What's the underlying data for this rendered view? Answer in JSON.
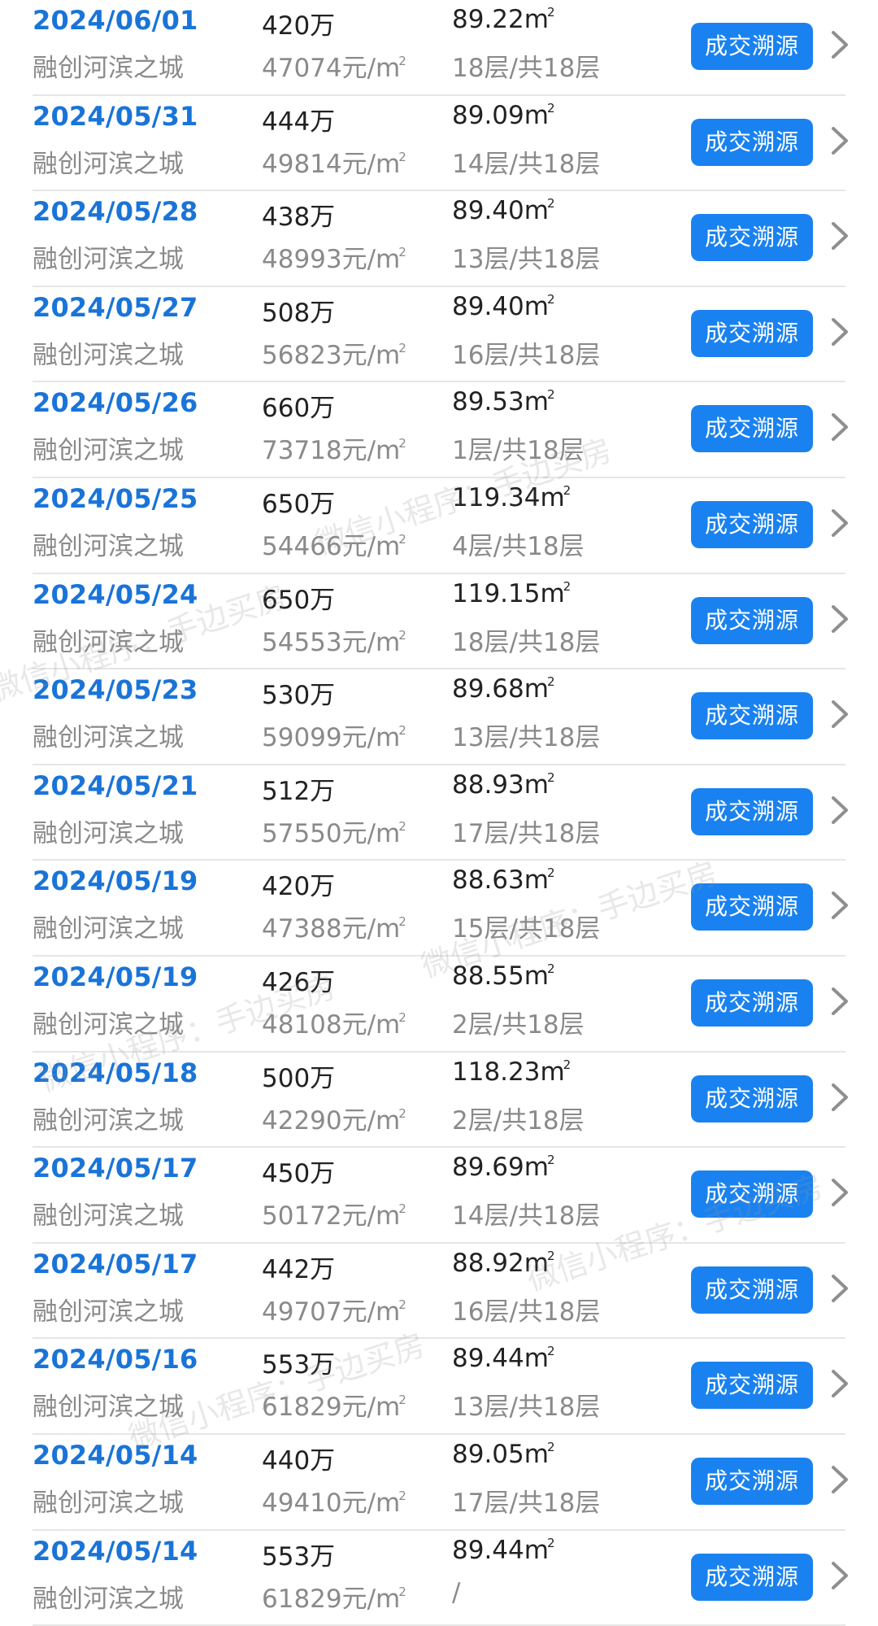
{
  "button_label": "成交溯源",
  "area_unit_sup": "2",
  "watermark_text": "微信小程序：手边买房",
  "icons": {
    "row_chevron": "chevron-right-icon"
  },
  "colors": {
    "date": "#1a74d8",
    "button_bg": "#1a82f0",
    "primary_text": "#222222",
    "secondary_text": "#8a8a8a",
    "divider": "#e6e6e6"
  },
  "rows": [
    {
      "date": "2024/06/01",
      "project": "融创河滨之城",
      "price": "420万",
      "unit_price": "47074元/m",
      "area": "89.22m",
      "floor": "18层/共18层"
    },
    {
      "date": "2024/05/31",
      "project": "融创河滨之城",
      "price": "444万",
      "unit_price": "49814元/m",
      "area": "89.09m",
      "floor": "14层/共18层"
    },
    {
      "date": "2024/05/28",
      "project": "融创河滨之城",
      "price": "438万",
      "unit_price": "48993元/m",
      "area": "89.40m",
      "floor": "13层/共18层"
    },
    {
      "date": "2024/05/27",
      "project": "融创河滨之城",
      "price": "508万",
      "unit_price": "56823元/m",
      "area": "89.40m",
      "floor": "16层/共18层"
    },
    {
      "date": "2024/05/26",
      "project": "融创河滨之城",
      "price": "660万",
      "unit_price": "73718元/m",
      "area": "89.53m",
      "floor": "1层/共18层"
    },
    {
      "date": "2024/05/25",
      "project": "融创河滨之城",
      "price": "650万",
      "unit_price": "54466元/m",
      "area": "119.34m",
      "floor": "4层/共18层"
    },
    {
      "date": "2024/05/24",
      "project": "融创河滨之城",
      "price": "650万",
      "unit_price": "54553元/m",
      "area": "119.15m",
      "floor": "18层/共18层"
    },
    {
      "date": "2024/05/23",
      "project": "融创河滨之城",
      "price": "530万",
      "unit_price": "59099元/m",
      "area": "89.68m",
      "floor": "13层/共18层"
    },
    {
      "date": "2024/05/21",
      "project": "融创河滨之城",
      "price": "512万",
      "unit_price": "57550元/m",
      "area": "88.93m",
      "floor": "17层/共18层"
    },
    {
      "date": "2024/05/19",
      "project": "融创河滨之城",
      "price": "420万",
      "unit_price": "47388元/m",
      "area": "88.63m",
      "floor": "15层/共18层"
    },
    {
      "date": "2024/05/19",
      "project": "融创河滨之城",
      "price": "426万",
      "unit_price": "48108元/m",
      "area": "88.55m",
      "floor": "2层/共18层"
    },
    {
      "date": "2024/05/18",
      "project": "融创河滨之城",
      "price": "500万",
      "unit_price": "42290元/m",
      "area": "118.23m",
      "floor": "2层/共18层"
    },
    {
      "date": "2024/05/17",
      "project": "融创河滨之城",
      "price": "450万",
      "unit_price": "50172元/m",
      "area": "89.69m",
      "floor": "14层/共18层"
    },
    {
      "date": "2024/05/17",
      "project": "融创河滨之城",
      "price": "442万",
      "unit_price": "49707元/m",
      "area": "88.92m",
      "floor": "16层/共18层"
    },
    {
      "date": "2024/05/16",
      "project": "融创河滨之城",
      "price": "553万",
      "unit_price": "61829元/m",
      "area": "89.44m",
      "floor": "13层/共18层"
    },
    {
      "date": "2024/05/14",
      "project": "融创河滨之城",
      "price": "440万",
      "unit_price": "49410元/m",
      "area": "89.05m",
      "floor": "17层/共18层"
    },
    {
      "date": "2024/05/14",
      "project": "融创河滨之城",
      "price": "553万",
      "unit_price": "61829元/m",
      "area": "89.44m",
      "floor": "/"
    }
  ]
}
